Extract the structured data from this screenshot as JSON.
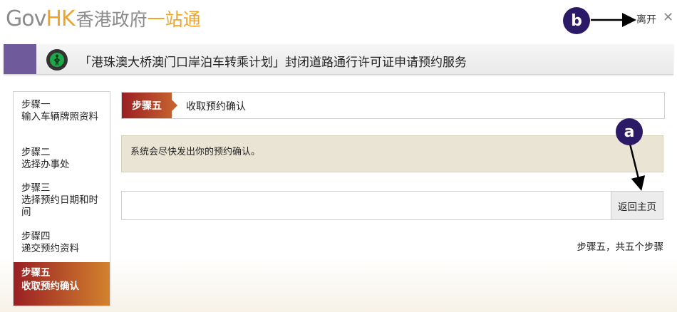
{
  "header": {
    "logo_gov": "Gov",
    "logo_hk": "HK",
    "logo_zh_grey": "香港政府",
    "logo_zh_orange": "一站通",
    "leave_label": "离开",
    "close_glyph": "✕"
  },
  "title": {
    "text": "「港珠澳大桥澳门口岸泊车转乘计划」封闭道路通行许可证申请预约服务",
    "icon": "pedestrian-traffic-light-icon"
  },
  "steps": [
    {
      "title": "步骤一",
      "desc": "输入车辆牌照资料"
    },
    {
      "title": "步骤二",
      "desc": "选择办事处"
    },
    {
      "title": "步骤三",
      "desc": "选择预约日期和时间"
    },
    {
      "title": "步骤四",
      "desc": "递交预约资料"
    },
    {
      "title": "步骤五",
      "desc": "收取预约确认",
      "active": true
    }
  ],
  "main": {
    "step_badge": "步骤五",
    "step_heading": "收取预约确认",
    "notice": "系统会尽快发出你的预约确认。",
    "home_button": "返回主页",
    "step_count": "步骤五，共五个步骤"
  },
  "annotations": {
    "a": "a",
    "b": "b"
  },
  "colors": {
    "accent_purple": "#6f5a9c",
    "step_red": "#9a1f23",
    "step_orange": "#d2822e",
    "notice_bg": "#e9e4d3",
    "marker": "#2b1a66",
    "logo_orange": "#f0a52a"
  }
}
